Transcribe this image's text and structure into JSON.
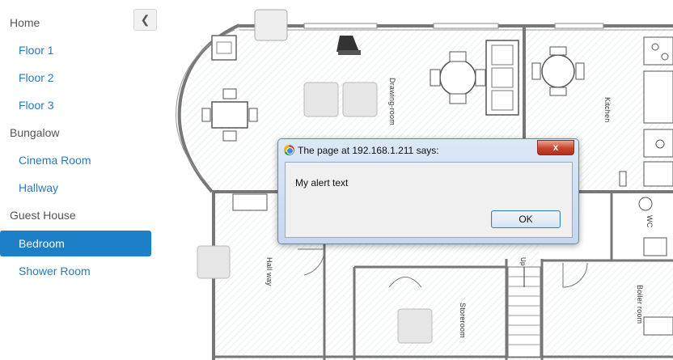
{
  "sidebar": {
    "items": [
      {
        "label": "Home",
        "kind": "group"
      },
      {
        "label": "Floor 1",
        "kind": "sub"
      },
      {
        "label": "Floor 2",
        "kind": "sub"
      },
      {
        "label": "Floor 3",
        "kind": "sub"
      },
      {
        "label": "Bungalow",
        "kind": "group"
      },
      {
        "label": "Cinema Room",
        "kind": "sub"
      },
      {
        "label": "Hallway",
        "kind": "sub"
      },
      {
        "label": "Guest House",
        "kind": "group"
      },
      {
        "label": "Bedroom",
        "kind": "sub",
        "active": true
      },
      {
        "label": "Shower Room",
        "kind": "sub"
      }
    ],
    "collapse_icon": "chevron-left-icon",
    "active_color": "#1e7fc9",
    "link_color": "#2a7ab8"
  },
  "floorplan": {
    "labels": {
      "drawing_room": "Drawing-room",
      "kitchen": "Kitchen",
      "hallway": "Hall way",
      "storeroom": "Storeroom",
      "wc": "WC",
      "boiler_room": "Boiler room",
      "stairs": "Up"
    }
  },
  "alert": {
    "title": "The page at 192.168.1.211 says:",
    "message": "My alert text",
    "ok_label": "OK",
    "close_label": "x",
    "icon": "chrome-icon"
  }
}
